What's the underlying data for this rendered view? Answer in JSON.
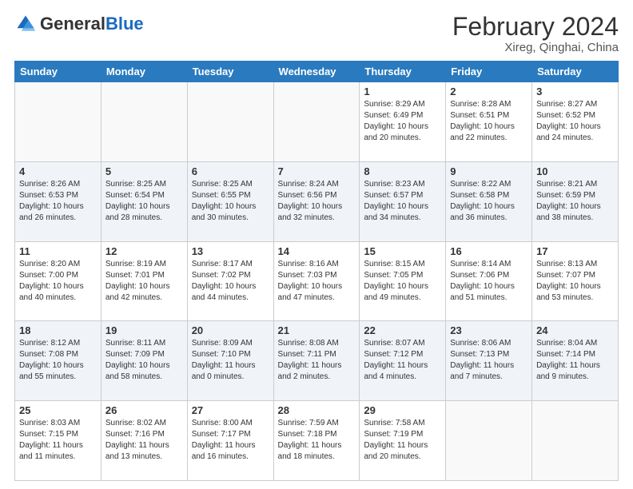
{
  "header": {
    "logo_general": "General",
    "logo_blue": "Blue",
    "month_year": "February 2024",
    "location": "Xireg, Qinghai, China"
  },
  "days_of_week": [
    "Sunday",
    "Monday",
    "Tuesday",
    "Wednesday",
    "Thursday",
    "Friday",
    "Saturday"
  ],
  "weeks": [
    {
      "days": [
        {
          "num": "",
          "info": ""
        },
        {
          "num": "",
          "info": ""
        },
        {
          "num": "",
          "info": ""
        },
        {
          "num": "",
          "info": ""
        },
        {
          "num": "1",
          "info": "Sunrise: 8:29 AM\nSunset: 6:49 PM\nDaylight: 10 hours\nand 20 minutes."
        },
        {
          "num": "2",
          "info": "Sunrise: 8:28 AM\nSunset: 6:51 PM\nDaylight: 10 hours\nand 22 minutes."
        },
        {
          "num": "3",
          "info": "Sunrise: 8:27 AM\nSunset: 6:52 PM\nDaylight: 10 hours\nand 24 minutes."
        }
      ]
    },
    {
      "days": [
        {
          "num": "4",
          "info": "Sunrise: 8:26 AM\nSunset: 6:53 PM\nDaylight: 10 hours\nand 26 minutes."
        },
        {
          "num": "5",
          "info": "Sunrise: 8:25 AM\nSunset: 6:54 PM\nDaylight: 10 hours\nand 28 minutes."
        },
        {
          "num": "6",
          "info": "Sunrise: 8:25 AM\nSunset: 6:55 PM\nDaylight: 10 hours\nand 30 minutes."
        },
        {
          "num": "7",
          "info": "Sunrise: 8:24 AM\nSunset: 6:56 PM\nDaylight: 10 hours\nand 32 minutes."
        },
        {
          "num": "8",
          "info": "Sunrise: 8:23 AM\nSunset: 6:57 PM\nDaylight: 10 hours\nand 34 minutes."
        },
        {
          "num": "9",
          "info": "Sunrise: 8:22 AM\nSunset: 6:58 PM\nDaylight: 10 hours\nand 36 minutes."
        },
        {
          "num": "10",
          "info": "Sunrise: 8:21 AM\nSunset: 6:59 PM\nDaylight: 10 hours\nand 38 minutes."
        }
      ]
    },
    {
      "days": [
        {
          "num": "11",
          "info": "Sunrise: 8:20 AM\nSunset: 7:00 PM\nDaylight: 10 hours\nand 40 minutes."
        },
        {
          "num": "12",
          "info": "Sunrise: 8:19 AM\nSunset: 7:01 PM\nDaylight: 10 hours\nand 42 minutes."
        },
        {
          "num": "13",
          "info": "Sunrise: 8:17 AM\nSunset: 7:02 PM\nDaylight: 10 hours\nand 44 minutes."
        },
        {
          "num": "14",
          "info": "Sunrise: 8:16 AM\nSunset: 7:03 PM\nDaylight: 10 hours\nand 47 minutes."
        },
        {
          "num": "15",
          "info": "Sunrise: 8:15 AM\nSunset: 7:05 PM\nDaylight: 10 hours\nand 49 minutes."
        },
        {
          "num": "16",
          "info": "Sunrise: 8:14 AM\nSunset: 7:06 PM\nDaylight: 10 hours\nand 51 minutes."
        },
        {
          "num": "17",
          "info": "Sunrise: 8:13 AM\nSunset: 7:07 PM\nDaylight: 10 hours\nand 53 minutes."
        }
      ]
    },
    {
      "days": [
        {
          "num": "18",
          "info": "Sunrise: 8:12 AM\nSunset: 7:08 PM\nDaylight: 10 hours\nand 55 minutes."
        },
        {
          "num": "19",
          "info": "Sunrise: 8:11 AM\nSunset: 7:09 PM\nDaylight: 10 hours\nand 58 minutes."
        },
        {
          "num": "20",
          "info": "Sunrise: 8:09 AM\nSunset: 7:10 PM\nDaylight: 11 hours\nand 0 minutes."
        },
        {
          "num": "21",
          "info": "Sunrise: 8:08 AM\nSunset: 7:11 PM\nDaylight: 11 hours\nand 2 minutes."
        },
        {
          "num": "22",
          "info": "Sunrise: 8:07 AM\nSunset: 7:12 PM\nDaylight: 11 hours\nand 4 minutes."
        },
        {
          "num": "23",
          "info": "Sunrise: 8:06 AM\nSunset: 7:13 PM\nDaylight: 11 hours\nand 7 minutes."
        },
        {
          "num": "24",
          "info": "Sunrise: 8:04 AM\nSunset: 7:14 PM\nDaylight: 11 hours\nand 9 minutes."
        }
      ]
    },
    {
      "days": [
        {
          "num": "25",
          "info": "Sunrise: 8:03 AM\nSunset: 7:15 PM\nDaylight: 11 hours\nand 11 minutes."
        },
        {
          "num": "26",
          "info": "Sunrise: 8:02 AM\nSunset: 7:16 PM\nDaylight: 11 hours\nand 13 minutes."
        },
        {
          "num": "27",
          "info": "Sunrise: 8:00 AM\nSunset: 7:17 PM\nDaylight: 11 hours\nand 16 minutes."
        },
        {
          "num": "28",
          "info": "Sunrise: 7:59 AM\nSunset: 7:18 PM\nDaylight: 11 hours\nand 18 minutes."
        },
        {
          "num": "29",
          "info": "Sunrise: 7:58 AM\nSunset: 7:19 PM\nDaylight: 11 hours\nand 20 minutes."
        },
        {
          "num": "",
          "info": ""
        },
        {
          "num": "",
          "info": ""
        }
      ]
    }
  ]
}
